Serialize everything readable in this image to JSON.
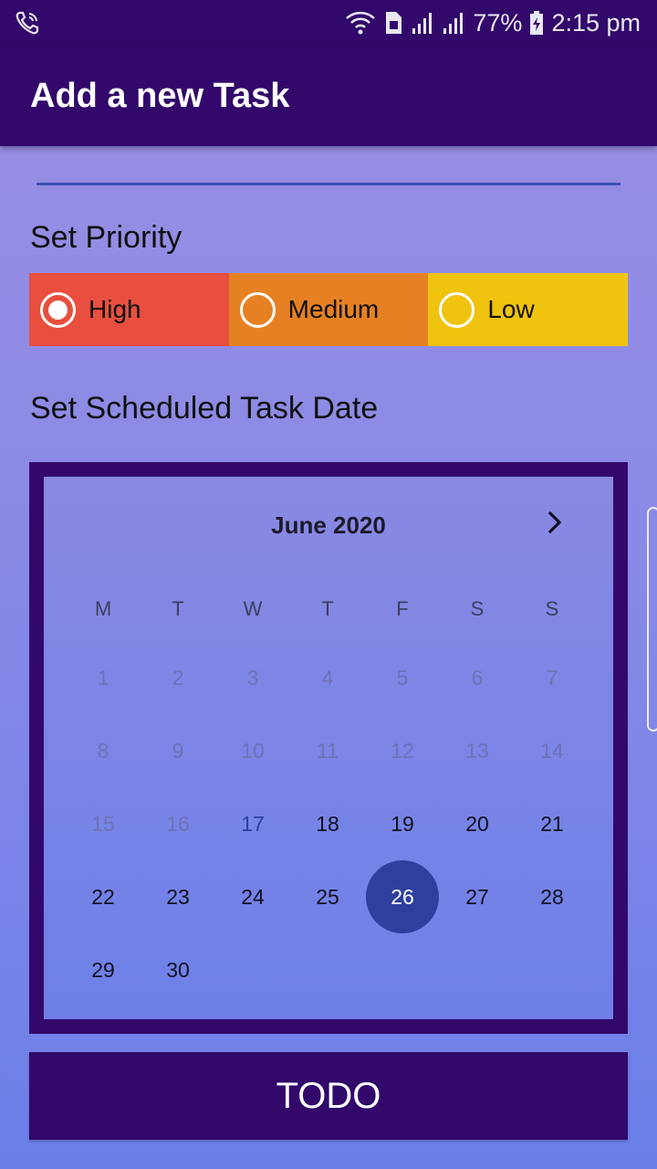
{
  "status_bar": {
    "left_icon": "wifi-call-icon",
    "battery_percent": "77%",
    "time": "2:15 pm",
    "icons": [
      "wifi-icon",
      "sim-icon",
      "signal-icon",
      "signal-icon",
      "battery-charging-icon"
    ]
  },
  "app_bar": {
    "title": "Add a new Task"
  },
  "priority": {
    "heading": "Set Priority",
    "options": [
      {
        "label": "High",
        "checked": true,
        "color": "#e84f3e"
      },
      {
        "label": "Medium",
        "checked": false,
        "color": "#e68123"
      },
      {
        "label": "Low",
        "checked": false,
        "color": "#f0c30f"
      }
    ]
  },
  "date": {
    "heading": "Set Scheduled Task Date"
  },
  "calendar": {
    "month": "June 2020",
    "weekdays": [
      "M",
      "T",
      "W",
      "T",
      "F",
      "S",
      "S"
    ],
    "weeks": [
      [
        "1",
        "2",
        "3",
        "4",
        "5",
        "6",
        "7"
      ],
      [
        "8",
        "9",
        "10",
        "11",
        "12",
        "13",
        "14"
      ],
      [
        "15",
        "16",
        "17",
        "18",
        "19",
        "20",
        "21"
      ],
      [
        "22",
        "23",
        "24",
        "25",
        "26",
        "27",
        "28"
      ],
      [
        "29",
        "30"
      ]
    ],
    "disabled_before": "17",
    "today": "17",
    "selected": "26",
    "selected_color": "#2f3f9e"
  },
  "button": {
    "label": "TODO"
  },
  "colors": {
    "primary": "#32096a",
    "accent": "#3b4db0"
  }
}
